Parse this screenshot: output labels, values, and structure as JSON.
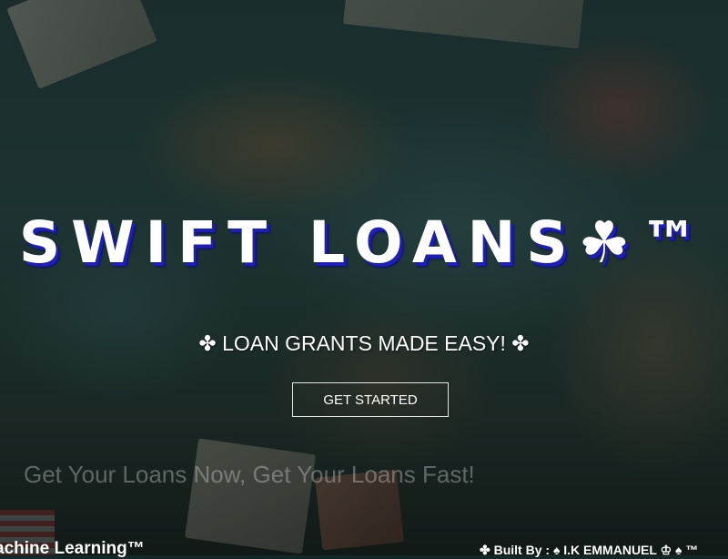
{
  "hero": {
    "brand": "SWIFT LOANS☘™",
    "tagline": "✤ LOAN GRANTS MADE EASY! ✤",
    "cta_label": "GET STARTED",
    "slogan": "Get Your Loans Now, Get Your Loans Fast!"
  },
  "footer": {
    "marquee_left": "achine Learning™",
    "marquee_right": "✤ Built By : ♠ I.K EMMANUEL ♔ ♠ ™"
  }
}
